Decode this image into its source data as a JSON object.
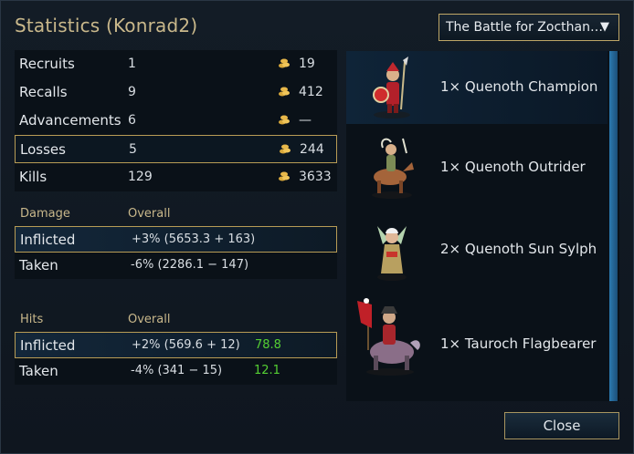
{
  "title": "Statistics (Konrad2)",
  "scenario_select": {
    "selected": "The Battle for Zocthan…"
  },
  "stats": [
    {
      "label": "Recruits",
      "count": "1",
      "gold": "19"
    },
    {
      "label": "Recalls",
      "count": "9",
      "gold": "412"
    },
    {
      "label": "Advancements",
      "count": "6",
      "gold": "—"
    },
    {
      "label": "Losses",
      "count": "5",
      "gold": "244"
    },
    {
      "label": "Kills",
      "count": "129",
      "gold": "3633"
    }
  ],
  "damage": {
    "heading": "Damage",
    "column": "Overall",
    "rows": [
      {
        "label": "Inflicted",
        "value": "+3% (5653.3 + 163)"
      },
      {
        "label": "Taken",
        "value": "-6% (2286.1 − 147)"
      }
    ]
  },
  "hits": {
    "heading": "Hits",
    "column": "Overall",
    "rows": [
      {
        "label": "Inflicted",
        "value": "+2% (569.6 + 12)",
        "pct": "78.8"
      },
      {
        "label": "Taken",
        "value": "-4% (341 − 15)",
        "pct": "12.1"
      }
    ]
  },
  "units": [
    {
      "name": "1× Quenoth Champion",
      "icon": "quenoth-champion-portrait"
    },
    {
      "name": "1× Quenoth Outrider",
      "icon": "quenoth-outrider-portrait"
    },
    {
      "name": "2× Quenoth Sun Sylph",
      "icon": "quenoth-sun-sylph-portrait"
    },
    {
      "name": "1× Tauroch Flagbearer",
      "icon": "tauroch-flagbearer-portrait"
    }
  ],
  "close_label": "Close",
  "colors": {
    "gold_title": "#c9b88b",
    "highlight_border": "#b89c55",
    "green_pct": "#55cf33",
    "scroll": "#2c7ab0"
  }
}
